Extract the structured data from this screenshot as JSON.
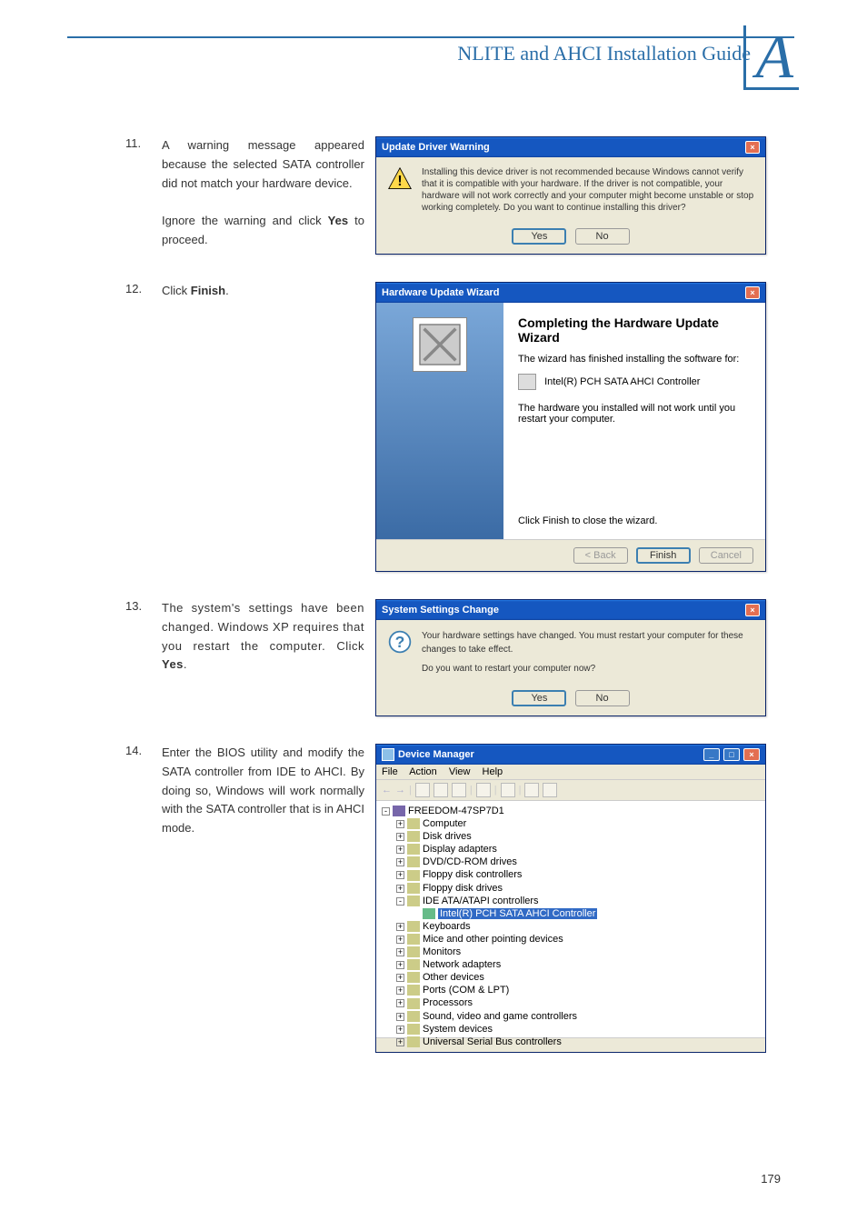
{
  "header": {
    "section_title": "NLITE and AHCI Installation Guide",
    "appendix_letter": "A"
  },
  "steps": {
    "s11": {
      "num": "11.",
      "text_a": "A warning message appeared because the selected SATA controller did not match your hardware device.",
      "text_b": "Ignore the warning and click ",
      "text_b_bold": "Yes",
      "text_b_after": " to proceed."
    },
    "s12": {
      "num": "12.",
      "text_a": "Click ",
      "text_bold": "Finish",
      "text_after": "."
    },
    "s13": {
      "num": "13.",
      "text_a": "The system's settings have been changed. Windows XP requires that you restart the computer. Click ",
      "text_bold": "Yes",
      "text_after": "."
    },
    "s14": {
      "num": "14.",
      "text": "Enter the BIOS utility and modify the SATA controller from IDE to AHCI. By doing so, Windows will work normally with the SATA controller that is in AHCI mode."
    }
  },
  "dialog_warning": {
    "title": "Update Driver Warning",
    "message": "Installing this device driver is not recommended because Windows cannot verify that it is compatible with your hardware. If the driver is not compatible, your hardware will not work correctly and your computer might become unstable or stop working completely. Do you want to continue installing this driver?",
    "yes": "Yes",
    "no": "No"
  },
  "wizard": {
    "title": "Hardware Update Wizard",
    "heading": "Completing the Hardware Update Wizard",
    "line1": "The wizard has finished installing the software for:",
    "device": "Intel(R) PCH SATA AHCI Controller",
    "line2": "The hardware you installed will not work until you restart your computer.",
    "line3": "Click Finish to close the wizard.",
    "back": "< Back",
    "finish": "Finish",
    "cancel": "Cancel"
  },
  "dialog_settings": {
    "title": "System Settings Change",
    "line1": "Your hardware settings have changed. You must restart your computer for these changes to take effect.",
    "line2": "Do you want to restart your computer now?",
    "yes": "Yes",
    "no": "No"
  },
  "devmgr": {
    "title": "Device Manager",
    "menu": {
      "file": "File",
      "action": "Action",
      "view": "View",
      "help": "Help"
    },
    "root": "FREEDOM-47SP7D1",
    "items": [
      {
        "label": "Computer",
        "expand": "+"
      },
      {
        "label": "Disk drives",
        "expand": "+"
      },
      {
        "label": "Display adapters",
        "expand": "+"
      },
      {
        "label": "DVD/CD-ROM drives",
        "expand": "+"
      },
      {
        "label": "Floppy disk controllers",
        "expand": "+"
      },
      {
        "label": "Floppy disk drives",
        "expand": "+"
      },
      {
        "label": "IDE ATA/ATAPI controllers",
        "expand": "-"
      },
      {
        "label": "Intel(R) PCH SATA AHCI Controller",
        "child": true,
        "selected": true
      },
      {
        "label": "Keyboards",
        "expand": "+"
      },
      {
        "label": "Mice and other pointing devices",
        "expand": "+"
      },
      {
        "label": "Monitors",
        "expand": "+"
      },
      {
        "label": "Network adapters",
        "expand": "+"
      },
      {
        "label": "Other devices",
        "expand": "+"
      },
      {
        "label": "Ports (COM & LPT)",
        "expand": "+"
      },
      {
        "label": "Processors",
        "expand": "+"
      },
      {
        "label": "Sound, video and game controllers",
        "expand": "+"
      },
      {
        "label": "System devices",
        "expand": "+"
      },
      {
        "label": "Universal Serial Bus controllers",
        "expand": "+"
      }
    ]
  },
  "page_number": "179"
}
